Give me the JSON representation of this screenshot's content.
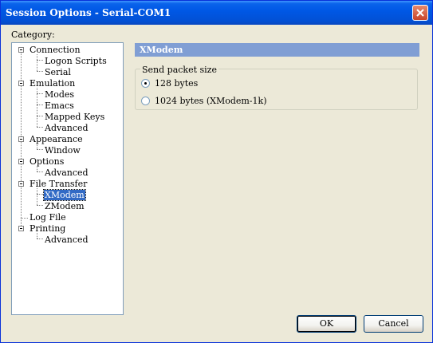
{
  "window": {
    "title": "Session Options - Serial-COM1"
  },
  "category_label": "Category:",
  "tree": {
    "connection": "Connection",
    "logon_scripts": "Logon Scripts",
    "serial": "Serial",
    "emulation": "Emulation",
    "modes": "Modes",
    "emacs": "Emacs",
    "mapped_keys": "Mapped Keys",
    "emulation_advanced": "Advanced",
    "appearance": "Appearance",
    "window": "Window",
    "options": "Options",
    "options_advanced": "Advanced",
    "file_transfer": "File Transfer",
    "xmodem": "XModem",
    "zmodem": "ZModem",
    "log_file": "Log File",
    "printing": "Printing",
    "printing_advanced": "Advanced",
    "selected": "XModem"
  },
  "panel": {
    "header": "XModem",
    "group_label": "Send packet size",
    "options": [
      {
        "label": "128 bytes",
        "checked": true
      },
      {
        "label": "1024 bytes  (XModem-1k)",
        "checked": false
      }
    ]
  },
  "buttons": {
    "ok": "OK",
    "cancel": "Cancel"
  },
  "colors": {
    "title_bar": "#0058e6",
    "panel_header": "#809ed4",
    "selection": "#316ac5",
    "dialog_bg": "#ece9d8"
  }
}
